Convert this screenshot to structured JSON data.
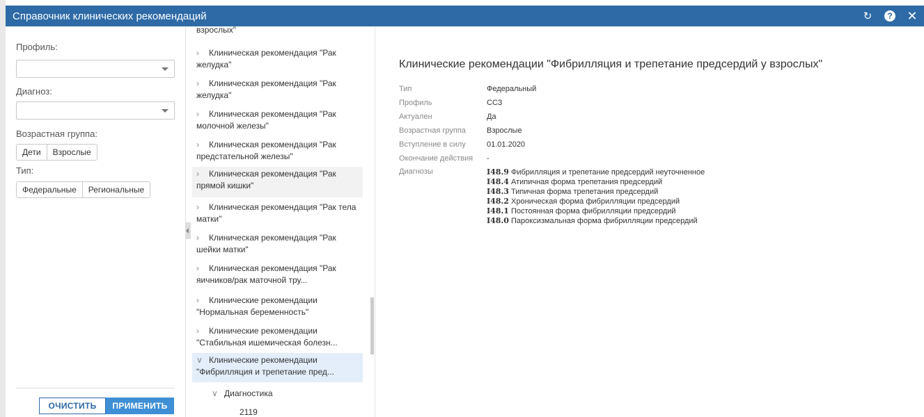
{
  "window": {
    "title": "Справочник клинических рекомендаций"
  },
  "filters": {
    "profile_label": "Профиль:",
    "diagnosis_label": "Диагноз:",
    "age_label": "Возрастная группа:",
    "age_options": [
      "Дети",
      "Взрослые"
    ],
    "type_label": "Тип:",
    "type_options": [
      "Федеральные",
      "Региональные"
    ],
    "clear_label": "ОЧИСТИТЬ",
    "apply_label": "ПРИМЕНИТЬ"
  },
  "tree": {
    "top_fragment": "взрослых\"",
    "items": [
      {
        "line1": "Клиническая рекомендация \"Рак",
        "line2": "желудка\""
      },
      {
        "line1": "Клиническая рекомендация \"Рак",
        "line2": "желудка\""
      },
      {
        "line1": "Клиническая рекомендация \"Рак",
        "line2": "молочной железы\""
      },
      {
        "line1": "Клиническая рекомендация \"Рак",
        "line2": "предстательной железы\""
      },
      {
        "line1": "Клиническая рекомендация \"Рак",
        "line2": "прямой кишки\""
      },
      {
        "line1": "Клиническая рекомендация \"Рак тела",
        "line2": "матки\""
      },
      {
        "line1": "Клиническая рекомендация \"Рак",
        "line2": "шейки матки\""
      },
      {
        "line1": "Клиническая рекомендация \"Рак",
        "line2": "яичников/рак маточной тру..."
      },
      {
        "line1": "Клинические рекомендации",
        "line2": "\"Нормальная беременность\""
      },
      {
        "line1": "Клинические рекомендации",
        "line2": "\"Стабильная ишемическая болезн..."
      },
      {
        "line1": "Клинические рекомендации",
        "line2": "\"Фибрилляция и трепетание пред..."
      }
    ],
    "sub_label": "Диагностика",
    "leaf_label": "2119"
  },
  "detail": {
    "title": "Клинические рекомендации \"Фибрилляция и трепетание предсердий у взрослых\"",
    "props": [
      {
        "key": "Тип",
        "value": "Федеральный"
      },
      {
        "key": "Профиль",
        "value": "ССЗ"
      },
      {
        "key": "Актуален",
        "value": "Да"
      },
      {
        "key": "Возрастная группа",
        "value": "Взрослые"
      },
      {
        "key": "Вступление в силу",
        "value": "01.01.2020"
      },
      {
        "key": "Окончание действия",
        "value": "-"
      },
      {
        "key": "Диагнозы",
        "value": ""
      }
    ],
    "diagnoses": [
      {
        "code": "I48.9",
        "text": "Фибрилляция и трепетание предсердий неуточненное"
      },
      {
        "code": "I48.4",
        "text": "Атипичная форма трепетания предсердий"
      },
      {
        "code": "I48.3",
        "text": "Типичная форма трепетания предсердий"
      },
      {
        "code": "I48.2",
        "text": "Хроническая форма фибрилляции предсердий"
      },
      {
        "code": "I48.1",
        "text": "Постоянная форма фибрилляции предсердий"
      },
      {
        "code": "I48.0",
        "text": "Пароксизмальная форма фибрилляции предсердий"
      }
    ]
  },
  "icons": [
    "refresh-icon",
    "help-icon",
    "close-icon"
  ]
}
